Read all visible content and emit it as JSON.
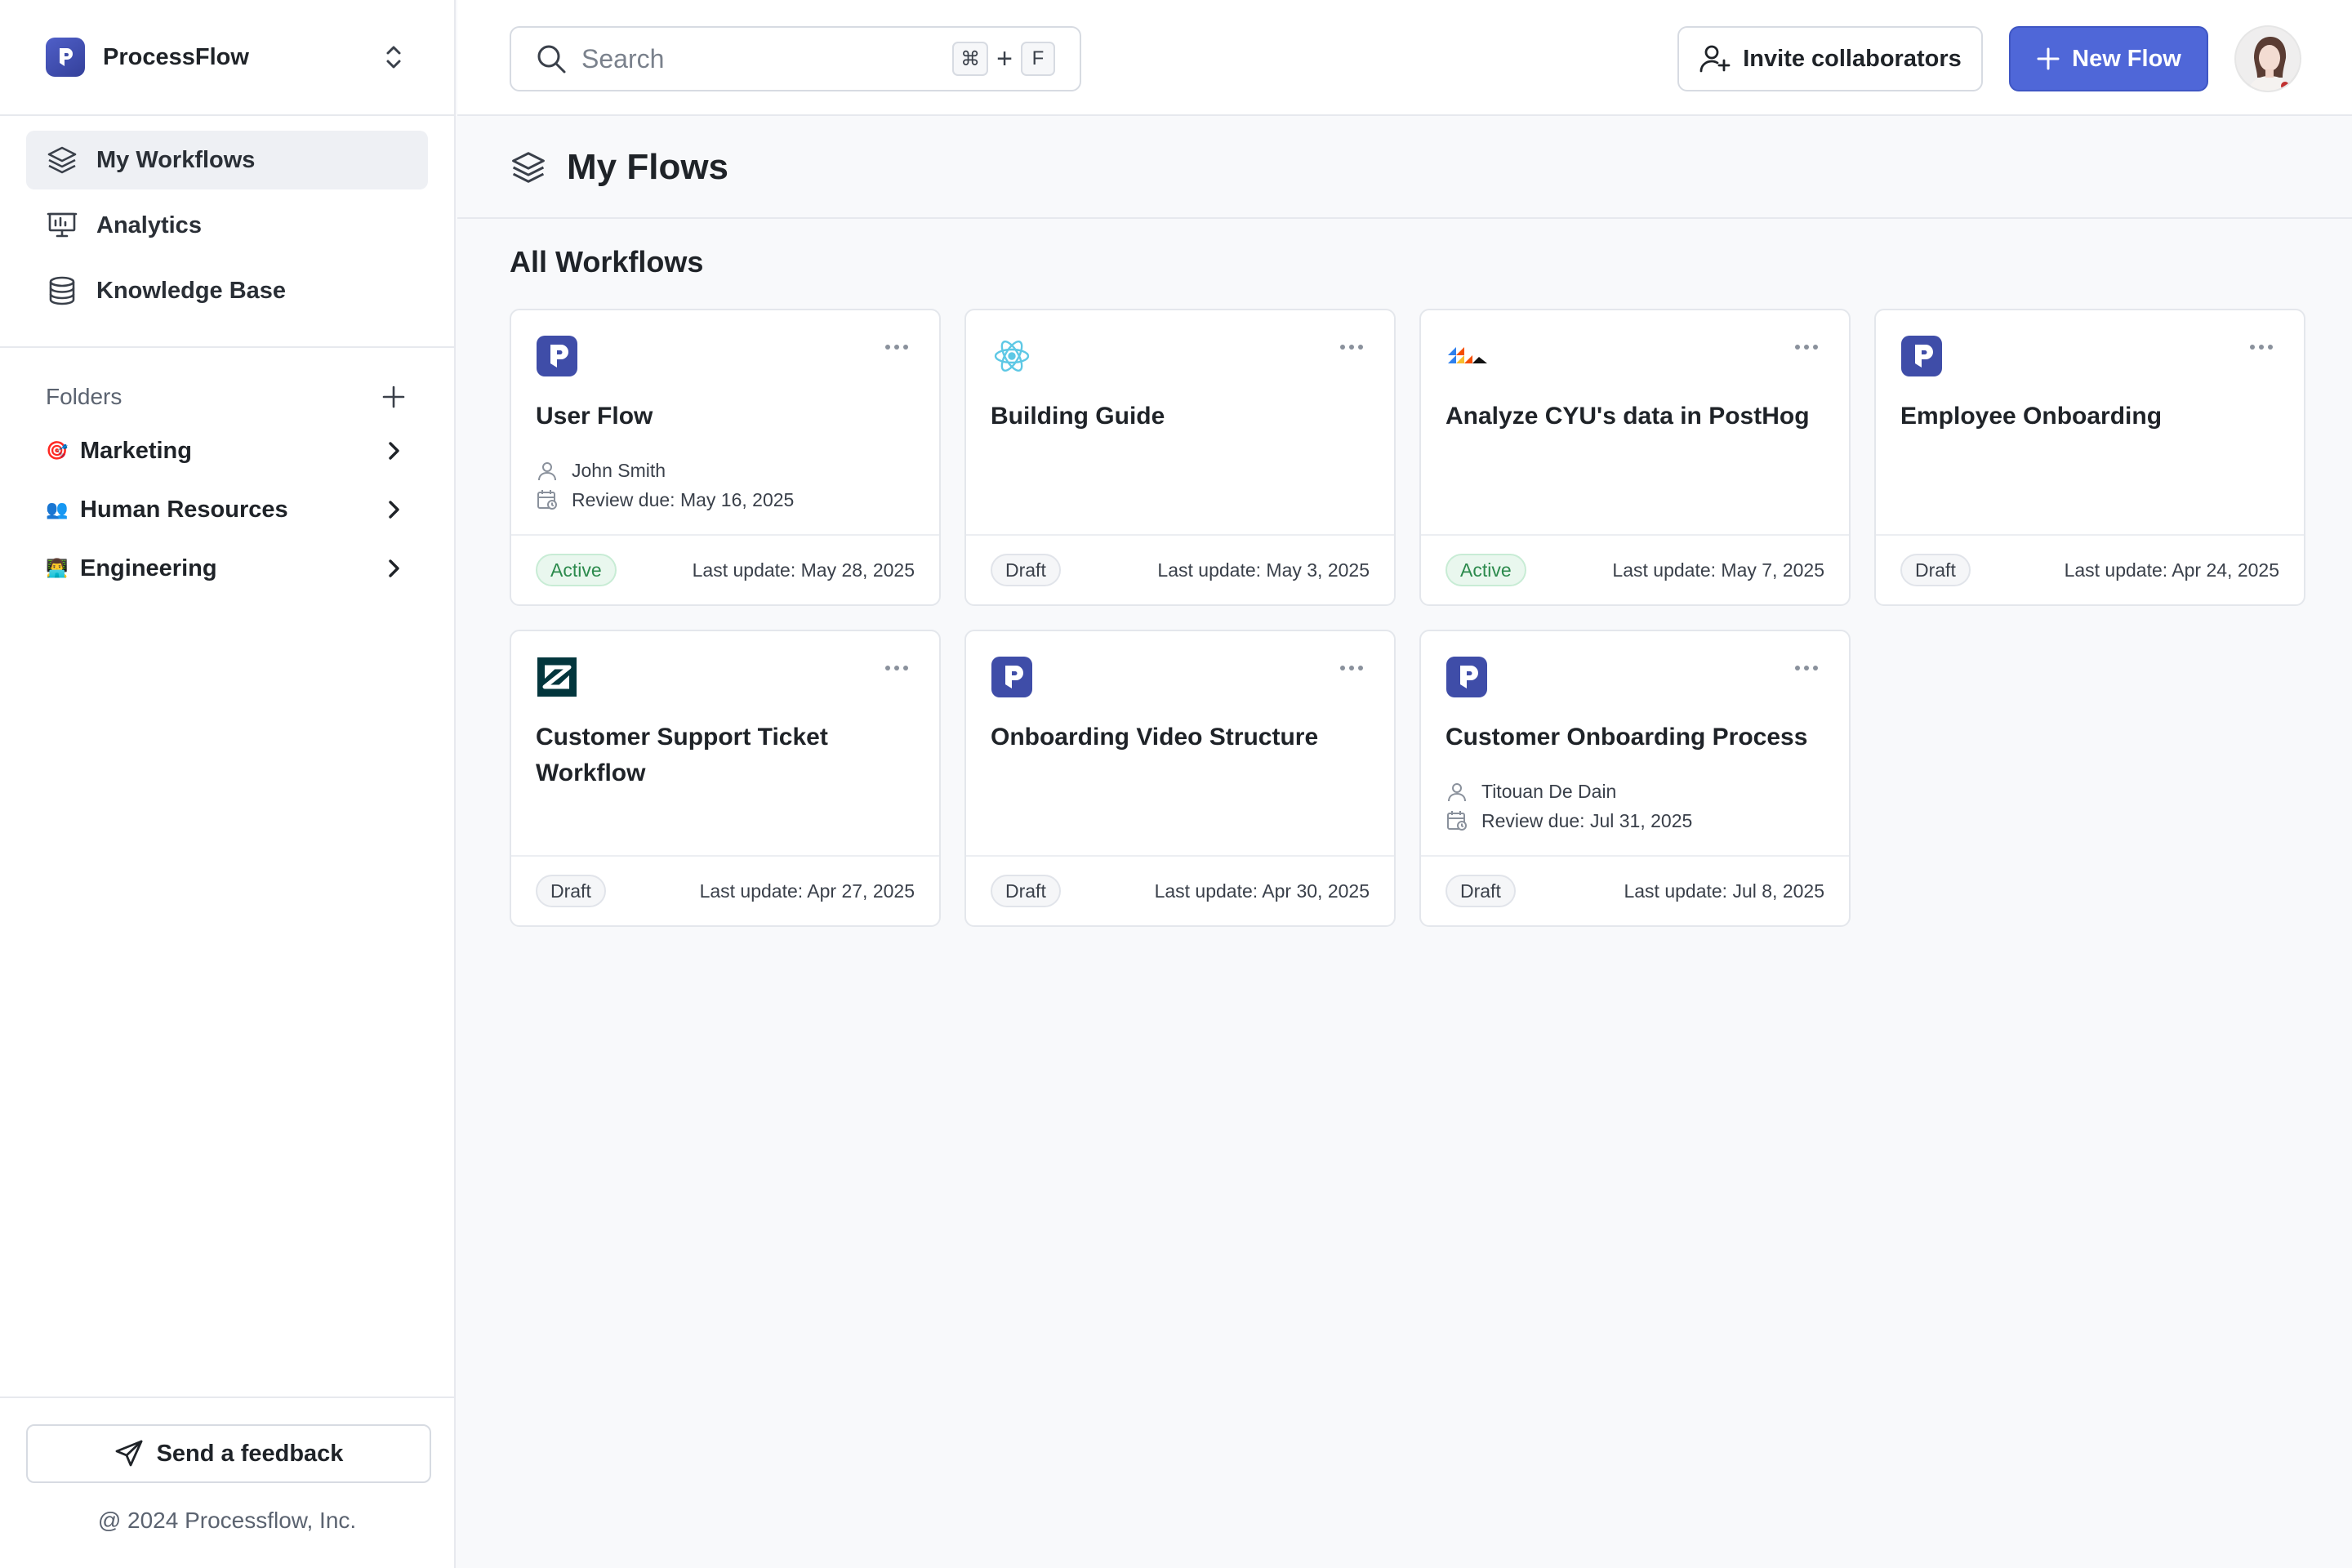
{
  "app": {
    "name": "ProcessFlow"
  },
  "sidebar": {
    "nav": [
      {
        "label": "My Workflows",
        "icon": "layers-icon",
        "active": true
      },
      {
        "label": "Analytics",
        "icon": "presentation-chart-icon",
        "active": false
      },
      {
        "label": "Knowledge Base",
        "icon": "database-icon",
        "active": false
      }
    ],
    "folders_title": "Folders",
    "folders": [
      {
        "emoji": "🎯",
        "label": "Marketing"
      },
      {
        "emoji": "👥",
        "label": "Human Resources"
      },
      {
        "emoji": "👨‍💻",
        "label": "Engineering"
      }
    ],
    "feedback_label": "Send a feedback",
    "copyright": "@ 2024 Processflow, Inc."
  },
  "topbar": {
    "search_placeholder": "Search",
    "shortcut_mod": "⌘",
    "shortcut_plus": "+",
    "shortcut_key": "F",
    "invite_label": "Invite collaborators",
    "new_flow_label": "New Flow"
  },
  "page": {
    "title": "My Flows",
    "section_title": "All Workflows"
  },
  "colors": {
    "accent": "#4f67d8",
    "active_badge": "#2b8a4c",
    "draft_badge": "#3a404a"
  },
  "workflows": [
    {
      "title": "User Flow",
      "logo": "processflow-logo",
      "assignee": "John Smith",
      "review_due": "Review due: May 16, 2025",
      "status": "Active",
      "last_update": "Last update: May 28, 2025"
    },
    {
      "title": "Building Guide",
      "logo": "react-logo",
      "status": "Draft",
      "last_update": "Last update: May 3, 2025"
    },
    {
      "title": "Analyze CYU's data in PostHog",
      "logo": "posthog-logo",
      "status": "Active",
      "last_update": "Last update: May 7, 2025"
    },
    {
      "title": "Employee Onboarding",
      "logo": "processflow-logo",
      "status": "Draft",
      "last_update": "Last update: Apr 24, 2025"
    },
    {
      "title": "Customer Support Ticket Workflow",
      "logo": "zendesk-logo",
      "status": "Draft",
      "last_update": "Last update: Apr 27, 2025"
    },
    {
      "title": "Onboarding Video Structure",
      "logo": "processflow-logo",
      "status": "Draft",
      "last_update": "Last update: Apr 30, 2025"
    },
    {
      "title": "Customer Onboarding Process",
      "logo": "processflow-logo",
      "assignee": "Titouan De Dain",
      "review_due": "Review due: Jul 31, 2025",
      "status": "Draft",
      "last_update": "Last update: Jul 8, 2025"
    }
  ]
}
